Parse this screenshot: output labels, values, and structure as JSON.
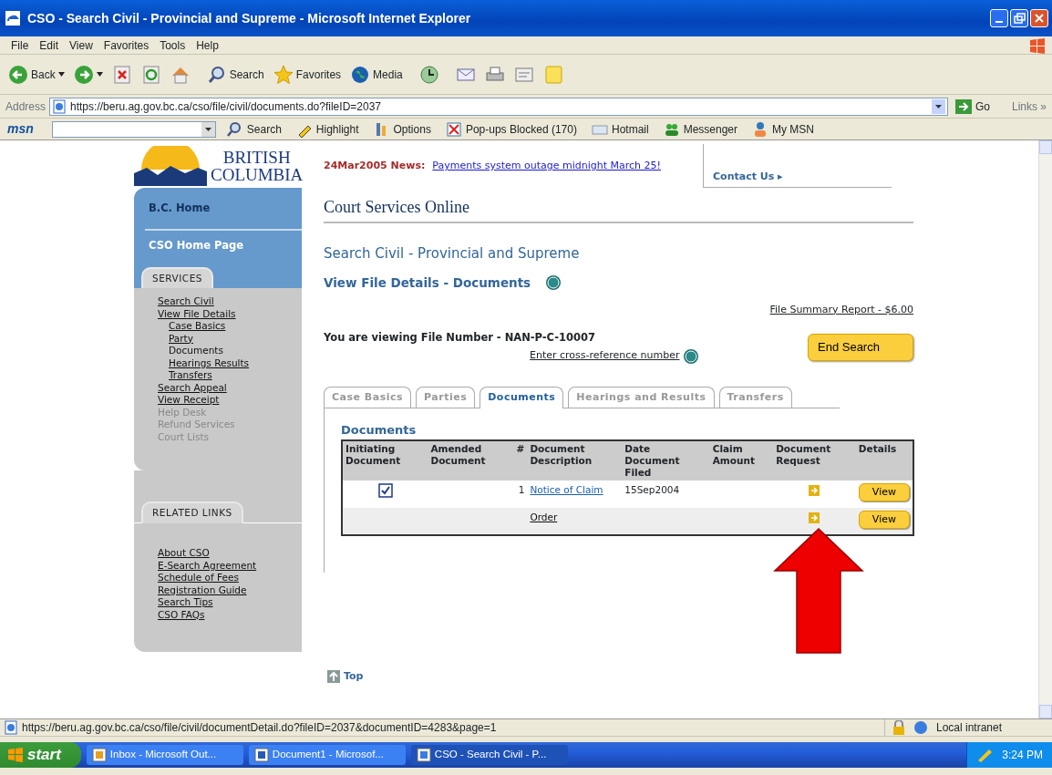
{
  "window": {
    "title": "CSO - Search Civil - Provincial and Supreme - Microsoft Internet Explorer"
  },
  "menu": [
    "File",
    "Edit",
    "View",
    "Favorites",
    "Tools",
    "Help"
  ],
  "toolbar": [
    {
      "kind": "back",
      "label": "Back"
    },
    {
      "kind": "forward"
    },
    {
      "kind": "stop"
    },
    {
      "kind": "refresh"
    },
    {
      "kind": "home"
    },
    {
      "kind": "search",
      "label": "Search"
    },
    {
      "kind": "favorites",
      "label": "Favorites"
    },
    {
      "kind": "media",
      "label": "Media"
    },
    {
      "kind": "history"
    },
    {
      "kind": "mail"
    },
    {
      "kind": "print"
    },
    {
      "kind": "edit"
    },
    {
      "kind": "note"
    }
  ],
  "address_bar": {
    "label": "Address",
    "url": "https://beru.ag.gov.bc.ca/cso/file/civil/documents.do?fileID=2037",
    "go": "Go",
    "links": "Links »"
  },
  "msn_bar": {
    "logo": "msn",
    "items": [
      {
        "kind": "search",
        "label": "Search"
      },
      {
        "kind": "highlight",
        "label": "Highlight"
      },
      {
        "kind": "options",
        "label": "Options"
      },
      {
        "kind": "popup",
        "label": "Pop-ups Blocked (170)"
      },
      {
        "kind": "hotmail",
        "label": "Hotmail"
      },
      {
        "kind": "messenger",
        "label": "Messenger"
      },
      {
        "kind": "mymsn",
        "label": "My MSN"
      }
    ]
  },
  "page": {
    "logo": {
      "line1": "BRITISH",
      "line2": "COLUMBIA"
    },
    "news": {
      "label": "24Mar2005 News:",
      "link": "Payments system outage midnight March 25!"
    },
    "contact": "Contact Us ▸",
    "sidebar": {
      "top_links": [
        "B.C. Home",
        "CSO Home Page"
      ],
      "services": {
        "title": "SERVICES",
        "items": [
          {
            "label": "Search Civil",
            "disabled": false
          },
          {
            "label": "View File Details",
            "disabled": false,
            "children": [
              {
                "label": "Case Basics",
                "selected": false
              },
              {
                "label": "Party",
                "selected": false
              },
              {
                "label": "Documents",
                "selected": true
              },
              {
                "label": "Hearings Results",
                "selected": false
              },
              {
                "label": "Transfers",
                "selected": false
              }
            ]
          },
          {
            "label": "Search Appeal",
            "disabled": false
          },
          {
            "label": "View Receipt",
            "disabled": false
          },
          {
            "label": "Help Desk",
            "disabled": true
          },
          {
            "label": "Refund Services",
            "disabled": true
          },
          {
            "label": "Court Lists",
            "disabled": true
          }
        ]
      },
      "related": {
        "title": "RELATED LINKS",
        "items": [
          "About CSO",
          "E-Search Agreement",
          "Schedule of Fees",
          "Registration Guide",
          "Search Tips",
          "CSO FAQs"
        ]
      }
    },
    "site_title": "Court Services Online",
    "heading": "Search Civil - Provincial and Supreme",
    "subheading": "View File Details - Documents",
    "summary_link": "File Summary Report - $6.00",
    "file_text": "You are viewing File Number - NAN-P-C-10007",
    "cross_ref": "Enter cross-reference number",
    "end_search": "End Search",
    "tabs": [
      {
        "label": "Case Basics",
        "selected": false
      },
      {
        "label": "Parties",
        "selected": false
      },
      {
        "label": "Documents",
        "selected": true
      },
      {
        "label": "Hearings and Results",
        "selected": false
      },
      {
        "label": "Transfers",
        "selected": false
      }
    ],
    "table": {
      "title": "Documents",
      "columns": [
        "Initiating Document",
        "Amended Document",
        "#",
        "Document Description",
        "Date Document Filed",
        "Claim Amount",
        "Document Request",
        "Details"
      ],
      "rows": [
        {
          "initiating": {
            "checked": true
          },
          "number": "1",
          "description": "Notice of Claim",
          "visited": false,
          "date": "15Sep2004",
          "details": "View"
        },
        {
          "description": "Order",
          "visited": true,
          "details": "View"
        }
      ]
    },
    "top_link": "Top"
  },
  "status_bar": {
    "url": "https://beru.ag.gov.bc.ca/cso/file/civil/documentDetail.do?fileID=2037&documentID=4283&page=1",
    "zone": "Local intranet"
  },
  "taskbar": {
    "start": "start",
    "items": [
      {
        "label": "Inbox - Microsoft Out...",
        "selected": false
      },
      {
        "label": "Document1 - Microsof...",
        "selected": false
      },
      {
        "label": "CSO - Search Civil - P...",
        "selected": true
      }
    ],
    "clock": "3:24 PM"
  }
}
